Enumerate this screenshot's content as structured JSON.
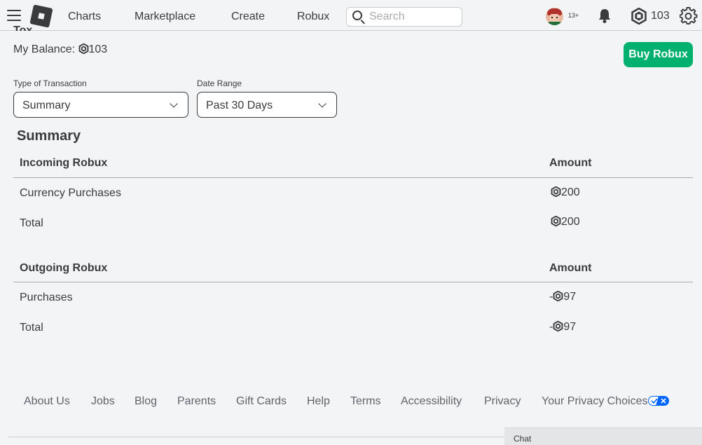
{
  "nav": {
    "links": [
      "Charts",
      "Marketplace",
      "Create",
      "Robux"
    ],
    "search_placeholder": "Search",
    "age_badge": "13+",
    "robux_count": "103"
  },
  "page": {
    "cut_title": "Tox",
    "balance_label": "My Balance:",
    "balance_value": "103",
    "buy_robux_label": "Buy Robux",
    "filters": {
      "type_label": "Type of Transaction",
      "type_value": "Summary",
      "date_label": "Date Range",
      "date_value": "Past 30 Days"
    },
    "summary_title": "Summary",
    "incoming": {
      "header": "Incoming Robux",
      "amount_header": "Amount",
      "rows": [
        {
          "label": "Currency Purchases",
          "amount": "200"
        },
        {
          "label": "Total",
          "amount": "200"
        }
      ]
    },
    "outgoing": {
      "header": "Outgoing Robux",
      "amount_header": "Amount",
      "sign": "-",
      "rows": [
        {
          "label": "Purchases",
          "amount": "97"
        },
        {
          "label": "Total",
          "amount": "97"
        }
      ]
    }
  },
  "footer": {
    "links": [
      "About Us",
      "Jobs",
      "Blog",
      "Parents",
      "Gift Cards",
      "Help",
      "Terms",
      "Accessibility",
      "Privacy",
      "Your Privacy Choices"
    ]
  },
  "chat": {
    "label": "Chat"
  },
  "colors": {
    "accent_green": "#00b06f",
    "background": "#f2f4f5",
    "text": "#393b3d"
  }
}
